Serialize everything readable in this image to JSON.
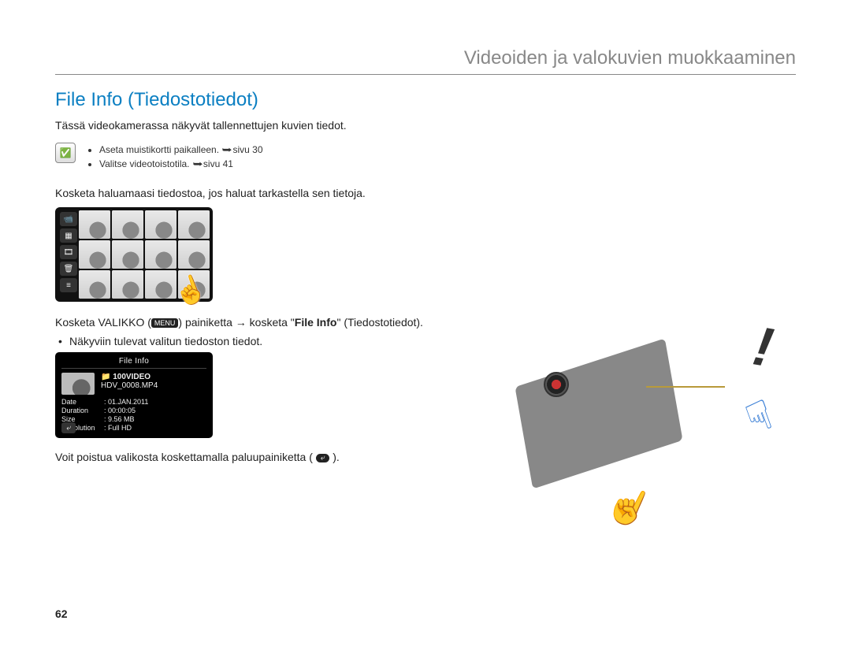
{
  "chapter_title": "Videoiden ja valokuvien muokkaaminen",
  "section_title": "File Info (Tiedostotiedot)",
  "intro_text": "Tässä videokamerassa näkyvät tallennettujen kuvien tiedot.",
  "prereq": {
    "items": [
      {
        "text": "Aseta muistikortti paikalleen. ",
        "page_ref": "sivu 30"
      },
      {
        "text": "Valitse videotoistotila. ",
        "page_ref": "sivu 41"
      }
    ]
  },
  "step1": "Kosketa haluamaasi tiedostoa, jos haluat tarkastella sen tietoja.",
  "step2_before": "Kosketa VALIKKO (",
  "menu_chip": "MENU",
  "step2_mid": ") painiketta → kosketa \"",
  "step2_bold": "File Info",
  "step2_after": "\" (Tiedostotiedot).",
  "sub_bullet": "Näkyviin tulevat valitun tiedoston tiedot.",
  "file_info": {
    "title": "File Info",
    "folder": "100VIDEO",
    "filename": "HDV_0008.MP4",
    "rows": [
      {
        "label": "Date",
        "value": "01.JAN.2011"
      },
      {
        "label": "Duration",
        "value": "00:00:05"
      },
      {
        "label": "Size",
        "value": "9.56 MB"
      },
      {
        "label": "Resolution",
        "value": "Full HD"
      }
    ]
  },
  "exit_before": "Voit poistua valikosta koskettamalla paluupainiketta ( ",
  "return_chip": "⤶",
  "exit_after": " ).",
  "illus_excl": "!",
  "page_number": "62"
}
